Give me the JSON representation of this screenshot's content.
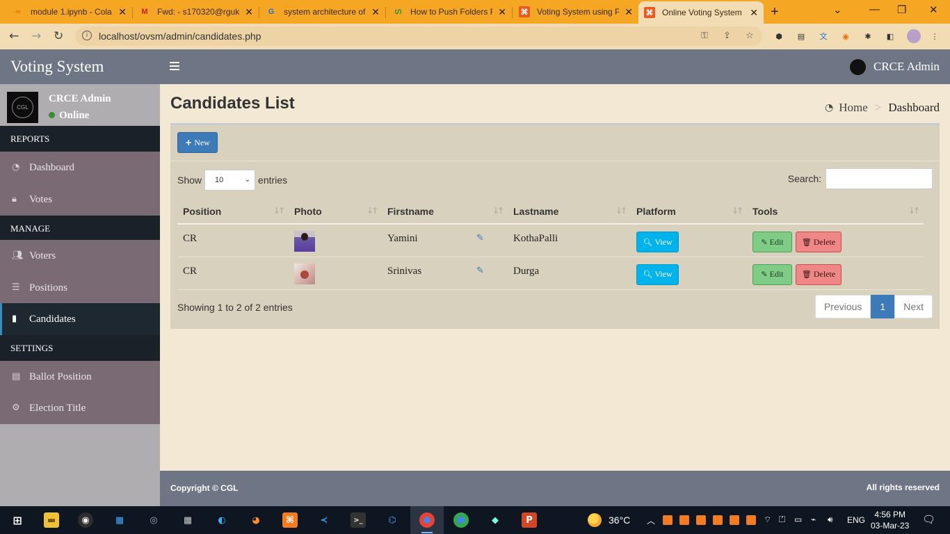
{
  "browser": {
    "tabs": [
      {
        "title": "module 1.ipynb - Cola",
        "favicon": "colab-icon"
      },
      {
        "title": "Fwd: - s170320@rguk",
        "favicon": "gmail-icon"
      },
      {
        "title": "system architecture of",
        "favicon": "google-icon"
      },
      {
        "title": "How to Push Folders F",
        "favicon": "gfg-icon"
      },
      {
        "title": "Voting System using P",
        "favicon": "xampp-icon"
      },
      {
        "title": "Online Voting System",
        "favicon": "xampp-icon",
        "active": true
      }
    ],
    "url": "localhost/ovsm/admin/candidates.php"
  },
  "app": {
    "brand": "Voting System",
    "top_user": "CRCE Admin"
  },
  "sidebar": {
    "user_name": "CRCE Admin",
    "user_status": "Online",
    "avatar_text": "CGL",
    "sections": {
      "reports": "REPORTS",
      "manage": "MANAGE",
      "settings": "SETTINGS"
    },
    "items": {
      "dashboard": "Dashboard",
      "votes": "Votes",
      "voters": "Voters",
      "positions": "Positions",
      "candidates": "Candidates",
      "ballot_position": "Ballot Position",
      "election_title": "Election Title"
    },
    "active": "Candidates"
  },
  "page": {
    "title": "Candidates List",
    "breadcrumb": {
      "home": "Home",
      "current": "Dashboard"
    },
    "new_button": "New"
  },
  "table": {
    "show_label": "Show",
    "entries_label": "entries",
    "page_length": "10",
    "search_label": "Search:",
    "search_value": "",
    "columns": [
      "Position",
      "Photo",
      "Firstname",
      "Lastname",
      "Platform",
      "Tools"
    ],
    "rows": [
      {
        "position": "CR",
        "firstname": "Yamini",
        "lastname": "KothaPalli"
      },
      {
        "position": "CR",
        "firstname": "Srinivas",
        "lastname": "Durga"
      }
    ],
    "view_label": "View",
    "edit_label": "Edit",
    "delete_label": "Delete",
    "info": "Showing 1 to 2 of 2 entries",
    "pagination": {
      "previous": "Previous",
      "current": "1",
      "next": "Next"
    }
  },
  "footer": {
    "copyright": "Copyright © CGL",
    "rights": "All rights reserved"
  },
  "taskbar": {
    "weather": "36°C",
    "lang": "ENG",
    "time": "4:56 PM",
    "date": "03-Mar-23"
  },
  "colors": {
    "header": "#6e7685",
    "sidebar_item": "#7a6a74",
    "sidebar_dark": "#1b2128",
    "primary": "#3c7ab8",
    "view": "#00b3ea",
    "edit": "#7fcc86",
    "delete": "#f08787",
    "tab_strip": "#f5a623"
  }
}
